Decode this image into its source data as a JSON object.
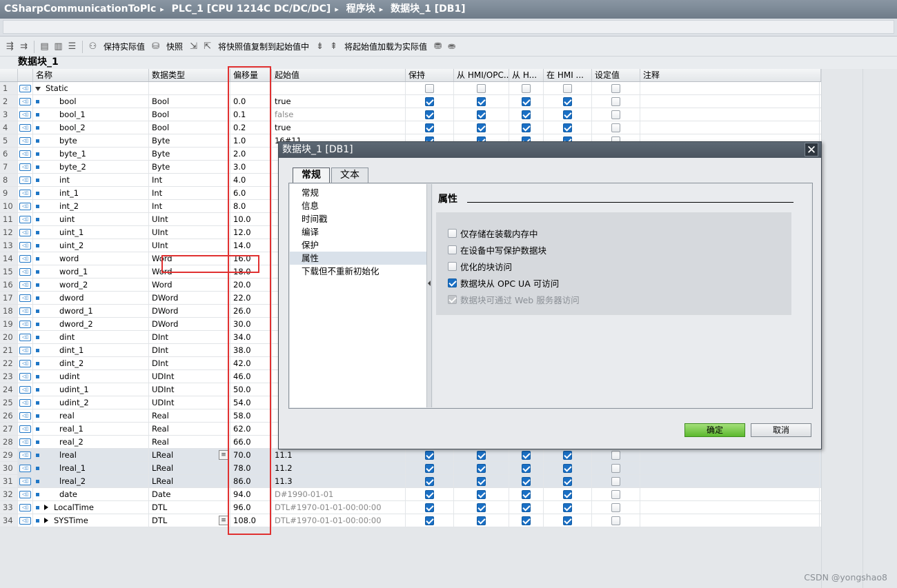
{
  "breadcrumb": [
    "CSharpCommunicationToPlc",
    "PLC_1 [CPU 1214C DC/DC/DC]",
    "程序块",
    "数据块_1 [DB1]"
  ],
  "toolbar": {
    "keep_actual": "保持实际值",
    "snapshot": "快照",
    "copy_snapshot": "将快照值复制到起始值中",
    "load_start": "将起始值加载为实际值"
  },
  "db_name": "数据块_1",
  "columns": {
    "name": "名称",
    "type": "数据类型",
    "offset": "偏移量",
    "start": "起始值",
    "retain": "保持",
    "hmi_opc": "从 HMI/OPC...",
    "hmi2": "从 H...",
    "hmi3": "在 HMI ...",
    "setpoint": "设定值",
    "comment": "注释"
  },
  "rows": [
    {
      "n": "1",
      "name": "Static",
      "type": "",
      "offset": "",
      "start": "",
      "flags": [
        0,
        0,
        0,
        0,
        0
      ]
    },
    {
      "n": "2",
      "name": "bool",
      "type": "Bool",
      "offset": "0.0",
      "start": "true",
      "flags": [
        1,
        1,
        1,
        1,
        0
      ]
    },
    {
      "n": "3",
      "name": "bool_1",
      "type": "Bool",
      "offset": "0.1",
      "start": "false",
      "flags": [
        1,
        1,
        1,
        1,
        0
      ]
    },
    {
      "n": "4",
      "name": "bool_2",
      "type": "Bool",
      "offset": "0.2",
      "start": "true",
      "flags": [
        1,
        1,
        1,
        1,
        0
      ]
    },
    {
      "n": "5",
      "name": "byte",
      "type": "Byte",
      "offset": "1.0",
      "start": "16#11",
      "flags": [
        1,
        1,
        1,
        1,
        0
      ]
    },
    {
      "n": "6",
      "name": "byte_1",
      "type": "Byte",
      "offset": "2.0",
      "start": "",
      "flags": [
        1,
        1,
        1,
        1,
        0
      ]
    },
    {
      "n": "7",
      "name": "byte_2",
      "type": "Byte",
      "offset": "3.0",
      "start": "",
      "flags": [
        1,
        1,
        1,
        1,
        0
      ]
    },
    {
      "n": "8",
      "name": "int",
      "type": "Int",
      "offset": "4.0",
      "start": "",
      "flags": [
        1,
        1,
        1,
        1,
        0
      ]
    },
    {
      "n": "9",
      "name": "int_1",
      "type": "Int",
      "offset": "6.0",
      "start": "",
      "flags": [
        1,
        1,
        1,
        1,
        0
      ]
    },
    {
      "n": "10",
      "name": "int_2",
      "type": "Int",
      "offset": "8.0",
      "start": "",
      "flags": [
        1,
        1,
        1,
        1,
        0
      ]
    },
    {
      "n": "11",
      "name": "uint",
      "type": "UInt",
      "offset": "10.0",
      "start": "",
      "flags": [
        1,
        1,
        1,
        1,
        0
      ]
    },
    {
      "n": "12",
      "name": "uint_1",
      "type": "UInt",
      "offset": "12.0",
      "start": "",
      "flags": [
        1,
        1,
        1,
        1,
        0
      ]
    },
    {
      "n": "13",
      "name": "uint_2",
      "type": "UInt",
      "offset": "14.0",
      "start": "",
      "flags": [
        1,
        1,
        1,
        1,
        0
      ]
    },
    {
      "n": "14",
      "name": "word",
      "type": "Word",
      "offset": "16.0",
      "start": "",
      "flags": [
        1,
        1,
        1,
        1,
        0
      ]
    },
    {
      "n": "15",
      "name": "word_1",
      "type": "Word",
      "offset": "18.0",
      "start": "",
      "flags": [
        1,
        1,
        1,
        1,
        0
      ]
    },
    {
      "n": "16",
      "name": "word_2",
      "type": "Word",
      "offset": "20.0",
      "start": "",
      "flags": [
        1,
        1,
        1,
        1,
        0
      ]
    },
    {
      "n": "17",
      "name": "dword",
      "type": "DWord",
      "offset": "22.0",
      "start": "",
      "flags": [
        1,
        1,
        1,
        1,
        0
      ]
    },
    {
      "n": "18",
      "name": "dword_1",
      "type": "DWord",
      "offset": "26.0",
      "start": "",
      "flags": [
        1,
        1,
        1,
        1,
        0
      ]
    },
    {
      "n": "19",
      "name": "dword_2",
      "type": "DWord",
      "offset": "30.0",
      "start": "",
      "flags": [
        1,
        1,
        1,
        1,
        0
      ]
    },
    {
      "n": "20",
      "name": "dint",
      "type": "DInt",
      "offset": "34.0",
      "start": "",
      "flags": [
        1,
        1,
        1,
        1,
        0
      ]
    },
    {
      "n": "21",
      "name": "dint_1",
      "type": "DInt",
      "offset": "38.0",
      "start": "",
      "flags": [
        1,
        1,
        1,
        1,
        0
      ]
    },
    {
      "n": "22",
      "name": "dint_2",
      "type": "DInt",
      "offset": "42.0",
      "start": "",
      "flags": [
        1,
        1,
        1,
        1,
        0
      ]
    },
    {
      "n": "23",
      "name": "udint",
      "type": "UDInt",
      "offset": "46.0",
      "start": "",
      "flags": [
        1,
        1,
        1,
        1,
        0
      ]
    },
    {
      "n": "24",
      "name": "udint_1",
      "type": "UDInt",
      "offset": "50.0",
      "start": "",
      "flags": [
        1,
        1,
        1,
        1,
        0
      ]
    },
    {
      "n": "25",
      "name": "udint_2",
      "type": "UDInt",
      "offset": "54.0",
      "start": "",
      "flags": [
        1,
        1,
        1,
        1,
        0
      ]
    },
    {
      "n": "26",
      "name": "real",
      "type": "Real",
      "offset": "58.0",
      "start": "",
      "flags": [
        1,
        1,
        1,
        1,
        0
      ]
    },
    {
      "n": "27",
      "name": "real_1",
      "type": "Real",
      "offset": "62.0",
      "start": "",
      "flags": [
        1,
        1,
        1,
        1,
        0
      ]
    },
    {
      "n": "28",
      "name": "real_2",
      "type": "Real",
      "offset": "66.0",
      "start": "",
      "flags": [
        1,
        1,
        1,
        1,
        0
      ]
    },
    {
      "n": "29",
      "name": "lreal",
      "type": "LReal",
      "offset": "70.0",
      "start": "11.1",
      "flags": [
        1,
        1,
        1,
        1,
        0
      ]
    },
    {
      "n": "30",
      "name": "lreal_1",
      "type": "LReal",
      "offset": "78.0",
      "start": "11.2",
      "flags": [
        1,
        1,
        1,
        1,
        0
      ]
    },
    {
      "n": "31",
      "name": "lreal_2",
      "type": "LReal",
      "offset": "86.0",
      "start": "11.3",
      "flags": [
        1,
        1,
        1,
        1,
        0
      ]
    },
    {
      "n": "32",
      "name": "date",
      "type": "Date",
      "offset": "94.0",
      "start": "D#1990-01-01",
      "flags": [
        1,
        1,
        1,
        1,
        0
      ]
    },
    {
      "n": "33",
      "name": "LocalTime",
      "type": "DTL",
      "offset": "96.0",
      "start": "DTL#1970-01-01-00:00:00",
      "flags": [
        1,
        1,
        1,
        1,
        0
      ]
    },
    {
      "n": "34",
      "name": "SYSTime",
      "type": "DTL",
      "offset": "108.0",
      "start": "DTL#1970-01-01-00:00:00",
      "flags": [
        1,
        1,
        1,
        1,
        0
      ]
    }
  ],
  "dialog": {
    "title": "数据块_1 [DB1]",
    "tabs": [
      "常规",
      "文本"
    ],
    "nav": [
      "常规",
      "信息",
      "时间戳",
      "编译",
      "保护",
      "属性",
      "下载但不重新初始化"
    ],
    "section_title": "属性",
    "options": [
      {
        "label": "仅存储在装载内存中",
        "checked": false,
        "disabled": false
      },
      {
        "label": "在设备中写保护数据块",
        "checked": false,
        "disabled": false
      },
      {
        "label": "优化的块访问",
        "checked": false,
        "disabled": false
      },
      {
        "label": "数据块从 OPC UA 可访问",
        "checked": true,
        "disabled": false
      },
      {
        "label": "数据块可通过 Web 服务器访问",
        "checked": true,
        "disabled": true
      }
    ],
    "ok": "确定",
    "cancel": "取消"
  },
  "watermark": "CSDN @yongshao8",
  "colors": {
    "accent": "#1a6fc4",
    "ok_button": "#5cb82e",
    "highlight": "#e03030"
  }
}
